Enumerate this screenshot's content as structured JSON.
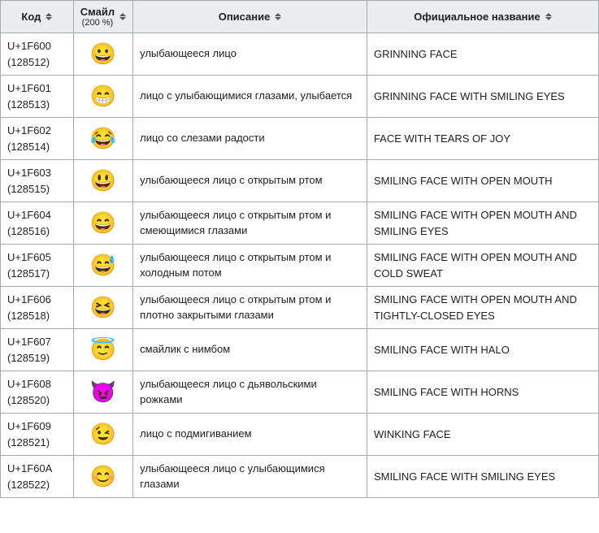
{
  "headers": {
    "code": "Код",
    "emoji_main": "Смайл",
    "emoji_sub": "(200 %)",
    "desc": "Описание",
    "name": "Официальное название"
  },
  "rows": [
    {
      "code": "U+1F600",
      "dec": "128512",
      "emoji": "😀",
      "desc": "улыбающееся лицо",
      "name": "GRINNING FACE"
    },
    {
      "code": "U+1F601",
      "dec": "128513",
      "emoji": "😁",
      "desc": "лицо с улыбающимися глазами, улыбается",
      "name": "GRINNING FACE WITH SMILING EYES"
    },
    {
      "code": "U+1F602",
      "dec": "128514",
      "emoji": "😂",
      "desc": "лицо со слезами радости",
      "name": "FACE WITH TEARS OF JOY"
    },
    {
      "code": "U+1F603",
      "dec": "128515",
      "emoji": "😃",
      "desc": "улыбающееся лицо с открытым ртом",
      "name": "SMILING FACE WITH OPEN MOUTH"
    },
    {
      "code": "U+1F604",
      "dec": "128516",
      "emoji": "😄",
      "desc": "улыбающееся лицо с открытым ртом и смеющимися глазами",
      "name": "SMILING FACE WITH OPEN MOUTH AND SMILING EYES"
    },
    {
      "code": "U+1F605",
      "dec": "128517",
      "emoji": "😅",
      "desc": "улыбающееся лицо с открытым ртом и холодным потом",
      "name": "SMILING FACE WITH OPEN MOUTH AND COLD SWEAT"
    },
    {
      "code": "U+1F606",
      "dec": "128518",
      "emoji": "😆",
      "desc": "улыбающееся лицо с открытым ртом и плотно закрытыми глазами",
      "name": "SMILING FACE WITH OPEN MOUTH AND TIGHTLY-CLOSED EYES"
    },
    {
      "code": "U+1F607",
      "dec": "128519",
      "emoji": "😇",
      "desc": "смайлик с нимбом",
      "name": "SMILING FACE WITH HALO"
    },
    {
      "code": "U+1F608",
      "dec": "128520",
      "emoji": "😈",
      "desc": "улыбающееся лицо с дьявольскими рожками",
      "name": "SMILING FACE WITH HORNS"
    },
    {
      "code": "U+1F609",
      "dec": "128521",
      "emoji": "😉",
      "desc": "лицо с подмигиванием",
      "name": "WINKING FACE"
    },
    {
      "code": "U+1F60A",
      "dec": "128522",
      "emoji": "😊",
      "desc": "улыбающееся лицо с улыбающимися глазами",
      "name": "SMILING FACE WITH SMILING EYES"
    }
  ]
}
